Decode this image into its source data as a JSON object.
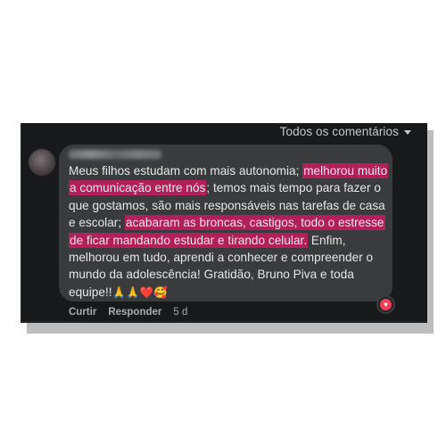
{
  "header": {
    "filter_label": "Todos os comentários"
  },
  "comment": {
    "author": "",
    "parts": [
      "Meus filhos estudam com mais autonomia;",
      "melhorou muito a comunicação entre nós",
      "; temos mais tempo para fazer o que gostamos, são mais responsáveis nas tarefas de casa e escolar;",
      "acabaram as broncas, castigos, todo o estresse de ficar mandando estudar e tirando celular.",
      " Enfim, melhorou em tudo, aprendi a conhecer e compreender o mundo da adolescência! Gratidão, Bruno Piva e toda equipe!!",
      "🙏🙏❤️🥰"
    ]
  },
  "actions": {
    "like": "Curtir",
    "reply": "Responder",
    "time": "5 d"
  },
  "reaction": {
    "icon": "heart-icon",
    "color": "#f33e58"
  },
  "colors": {
    "highlight": "#b21f5a",
    "bubble": "#3a3b3c",
    "panel": "#18191a"
  }
}
